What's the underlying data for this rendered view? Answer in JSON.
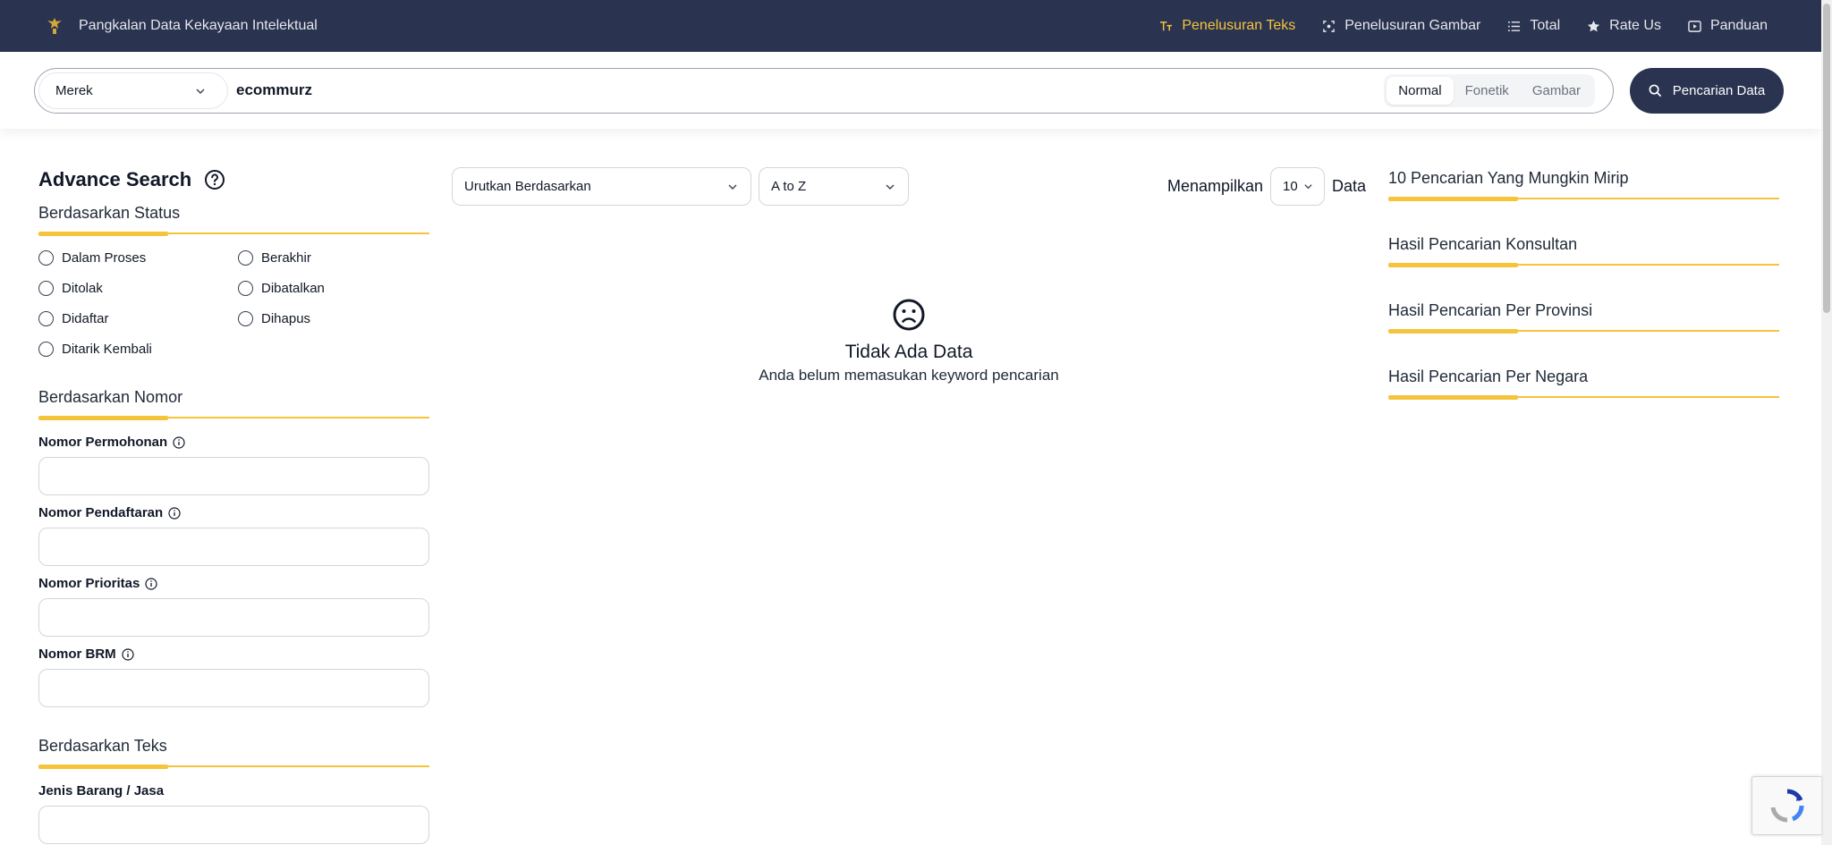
{
  "navbar": {
    "brand": "Pangkalan Data Kekayaan Intelektual",
    "links": [
      {
        "label": "Penelusuran Teks",
        "icon": "text-icon",
        "active": true
      },
      {
        "label": "Penelusuran Gambar",
        "icon": "image-scan-icon",
        "active": false
      },
      {
        "label": "Total",
        "icon": "list-icon",
        "active": false
      },
      {
        "label": "Rate Us",
        "icon": "star-icon",
        "active": false
      },
      {
        "label": "Panduan",
        "icon": "play-icon",
        "active": false
      }
    ]
  },
  "search": {
    "type_value": "Merek",
    "query": "ecommurz",
    "modes": [
      "Normal",
      "Fonetik",
      "Gambar"
    ],
    "active_mode": "Normal",
    "button_label": "Pencarian Data"
  },
  "sidebar": {
    "title": "Advance Search",
    "status_section": "Berdasarkan Status",
    "statuses": [
      "Dalam Proses",
      "Berakhir",
      "Ditolak",
      "Dibatalkan",
      "Didaftar",
      "Dihapus",
      "Ditarik Kembali"
    ],
    "number_section": "Berdasarkan Nomor",
    "number_fields": [
      "Nomor Permohonan",
      "Nomor Pendaftaran",
      "Nomor Prioritas",
      "Nomor BRM"
    ],
    "text_section": "Berdasarkan Teks",
    "text_fields": [
      "Jenis Barang / Jasa"
    ]
  },
  "results": {
    "sort_by": "Urutkan Berdasarkan",
    "sort_order": "A to Z",
    "show_label": "Menampilkan",
    "page_size": "10",
    "data_label": "Data",
    "empty_title": "Tidak Ada Data",
    "empty_subtitle": "Anda belum memasukan keyword pencarian"
  },
  "right_panel": {
    "sections": [
      "10 Pencarian Yang Mungkin Mirip",
      "Hasil Pencarian Konsultan",
      "Hasil Pencarian Per Provinsi",
      "Hasil Pencarian Per Negara"
    ]
  },
  "colors": {
    "navy": "#2a3350",
    "accent": "#f5c43a"
  }
}
